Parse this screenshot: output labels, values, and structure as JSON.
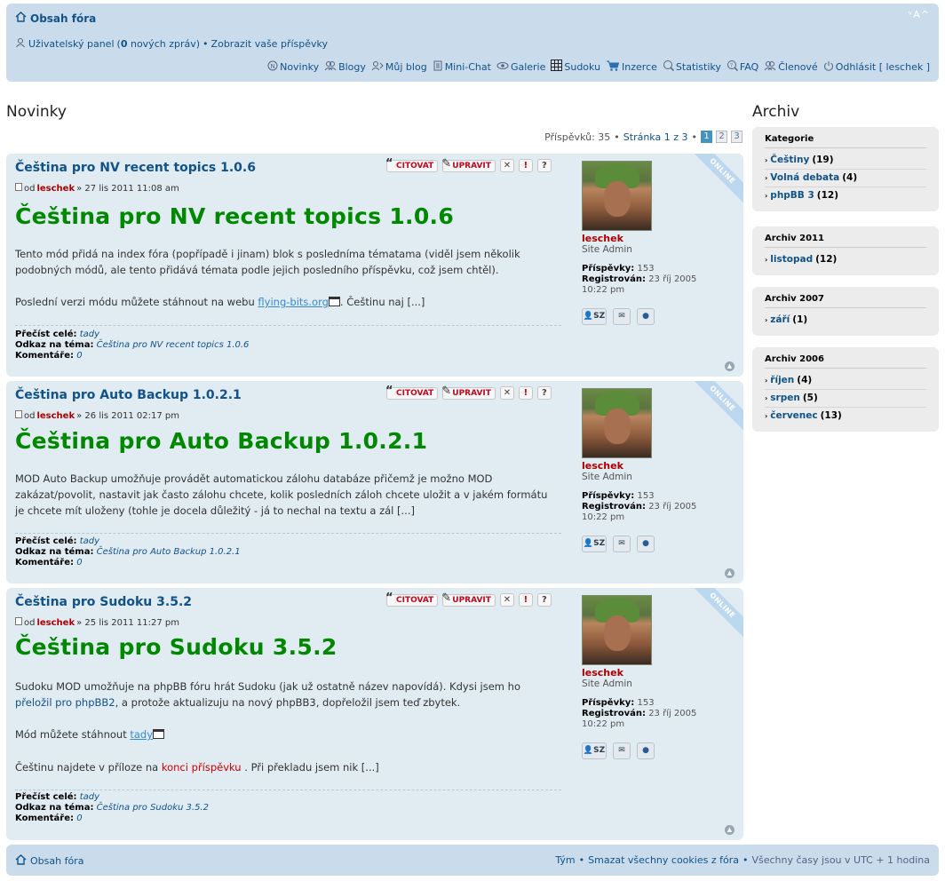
{
  "header": {
    "forum_index": "Obsah fóra",
    "font_size": "ᵛA^",
    "user_panel": "Uživatelský panel",
    "new_messages_count": "0",
    "new_messages_text": "nových zpráv",
    "show_posts": "Zobrazit vaše příspěvky",
    "nav": [
      {
        "label": "Novinky",
        "icon": "news-icon"
      },
      {
        "label": "Blogy",
        "icon": "blogs-icon"
      },
      {
        "label": "Můj blog",
        "icon": "my-blog-icon"
      },
      {
        "label": "Mini-Chat",
        "icon": "chat-icon"
      },
      {
        "label": "Galerie",
        "icon": "gallery-icon"
      },
      {
        "label": "Sudoku",
        "icon": "sudoku-icon"
      },
      {
        "label": "Inzerce",
        "icon": "cart-icon"
      },
      {
        "label": "Statistiky",
        "icon": "stats-icon"
      },
      {
        "label": "FAQ",
        "icon": "faq-icon"
      },
      {
        "label": "Členové",
        "icon": "members-icon"
      },
      {
        "label": "Odhlásit [ leschek ]",
        "icon": "logout-icon"
      }
    ]
  },
  "main_title": "Novinky",
  "pagination": {
    "posts_label": "Příspěvků: 35",
    "page_label": "Stránka",
    "page_of": "1 z 3",
    "pages": [
      "1",
      "2",
      "3"
    ],
    "active": "1"
  },
  "post_labels": {
    "quote": "CITOVAT",
    "edit": "UPRAVIT",
    "from": "od",
    "read_more": "Přečíst celé:",
    "topic_link": "Odkaz na téma:",
    "comments": "Komentáře:",
    "online": "ONLINE",
    "posts_label": "Příspěvky:",
    "registered_label": "Registrován:",
    "pm_btn": "SZ"
  },
  "posts": [
    {
      "title": "Čeština pro NV recent topics 1.0.6",
      "author": "leschek",
      "date": "» 27 lis 2011 11:08 am",
      "heading": "Čeština pro NV recent topics 1.0.6",
      "para1": "Tento mód přidá na index fóra (popřípadě i jinam) blok s posledníma tématama (viděl jsem několik podobných módů, ale tento přidává témata podle jejich posledního příspěvku, což jsem chtěl).",
      "para2_pre": "Poslední verzi módu můžete stáhnout na webu ",
      "para2_link": "flying-bits.org",
      "para2_post": ". Češtinu naj [...]",
      "read_more_link": "tady",
      "topic_link": "Čeština pro NV recent topics 1.0.6",
      "comments": "0",
      "profile": {
        "name": "leschek",
        "rank": "Site Admin",
        "posts": "153",
        "registered": "23 říj 2005",
        "reg_time": "10:22 pm"
      }
    },
    {
      "title": "Čeština pro Auto Backup 1.0.2.1",
      "author": "leschek",
      "date": "» 26 lis 2011 02:17 pm",
      "heading": "Čeština pro Auto Backup 1.0.2.1",
      "para1": "MOD Auto Backup umožňuje provádět automatickou zálohu databáze přičemž je možno MOD zakázat/povolit, nastavit jak často zálohu chcete, kolik posledních záloh chcete uložit a v jakém formátu je chcete mít uloženy (tohle je docela důležitý - já to nechal na textu a zál [...]",
      "read_more_link": "tady",
      "topic_link": "Čeština pro Auto Backup 1.0.2.1",
      "comments": "0",
      "profile": {
        "name": "leschek",
        "rank": "Site Admin",
        "posts": "153",
        "registered": "23 říj 2005",
        "reg_time": "10:22 pm"
      }
    },
    {
      "title": "Čeština pro Sudoku 3.5.2",
      "author": "leschek",
      "date": "» 25 lis 2011 11:27 pm",
      "heading": "Čeština pro Sudoku 3.5.2",
      "para1_pre": "Sudoku MOD umožňuje na phpBB fóru hrát Sudoku (jak už ostatně název napovídá). Kdysi jsem ho ",
      "para1_link": "přeložil pro phpBB2",
      "para1_post": ", a protože aktualizuju na nový phpBB3, dopřeložil jsem teď zbytek.",
      "para2_pre": "Mód můžete stáhnout ",
      "para2_link": "tady",
      "para3_pre": "Češtinu najdete v příloze na ",
      "para3_red": "konci příspěvku",
      "para3_post": " . Při překladu jsem nik [...]",
      "read_more_link": "tady",
      "topic_link": "Čeština pro Sudoku 3.5.2",
      "comments": "0",
      "profile": {
        "name": "leschek",
        "rank": "Site Admin",
        "posts": "153",
        "registered": "23 říj 2005",
        "reg_time": "10:22 pm"
      }
    }
  ],
  "sidebar": {
    "title": "Archiv",
    "boxes": [
      {
        "head": "Kategorie",
        "items": [
          {
            "name": "Češtiny",
            "count": "(19)"
          },
          {
            "name": "Volná debata",
            "count": "(4)"
          },
          {
            "name": "phpBB 3",
            "count": "(12)"
          }
        ]
      },
      {
        "head": "Archiv 2011",
        "items": [
          {
            "name": "listopad",
            "count": "(12)"
          }
        ]
      },
      {
        "head": "Archiv 2007",
        "items": [
          {
            "name": "září",
            "count": "(1)"
          }
        ]
      },
      {
        "head": "Archiv 2006",
        "items": [
          {
            "name": "říjen",
            "count": "(4)"
          },
          {
            "name": "srpen",
            "count": "(5)"
          },
          {
            "name": "červenec",
            "count": "(13)"
          }
        ]
      }
    ]
  },
  "footer": {
    "forum_index": "Obsah fóra",
    "team": "Tým",
    "delete_cookies": "Smazat všechny cookies z fóra",
    "timezone": "Všechny časy jsou v UTC + 1 hodina"
  }
}
